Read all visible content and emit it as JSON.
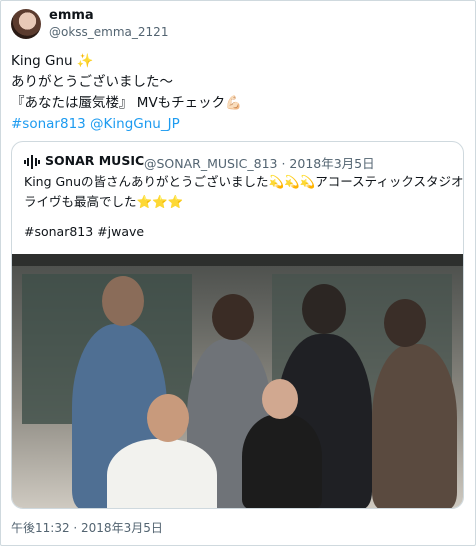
{
  "tweet": {
    "author_name": "emma",
    "author_handle": "@okss_emma_2121",
    "lines": [
      "King Gnu ✨",
      "ありがとうございました〜",
      "『あなたは蜃気楼』 MVもチェック💪🏻"
    ],
    "tags": "#sonar813 @KingGnu_JP",
    "timestamp": "午後11:32 · 2018年3月5日"
  },
  "quoted_tweet": {
    "author_name": "SONAR MUSIC",
    "author_handle": "@SONAR_MUSIC_813 · 2018年3月5日",
    "lines": [
      "King Gnuの皆さんありがとうございました💫💫💫アコースティックスタジオ",
      "ライヴも最高でした⭐⭐⭐"
    ],
    "tags": "#sonar813 #jwave"
  },
  "colors": {
    "link": "#1d9bf0",
    "secondary_text": "#536471",
    "border": "#cfd9de"
  },
  "icons": [
    "avatar",
    "sonar-logo-icon"
  ]
}
